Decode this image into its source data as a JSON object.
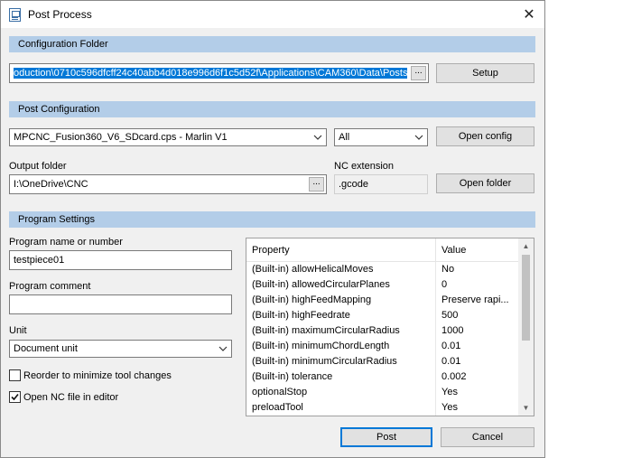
{
  "window": {
    "title": "Post Process",
    "close_glyph": "✕"
  },
  "sections": {
    "config_folder": "Configuration Folder",
    "post_config": "Post Configuration",
    "program_settings": "Program Settings"
  },
  "config_folder": {
    "path": "oduction\\0710c596dfcff24c40abb4d018e996d6f1c5d52f\\Applications\\CAM360\\Data\\Posts",
    "browse": "...",
    "setup_label": "Setup"
  },
  "post_config": {
    "post_selected": "MPCNC_Fusion360_V6_SDcard.cps - Marlin V1",
    "filter_selected": "All",
    "open_config_label": "Open config",
    "output_folder_label": "Output folder",
    "output_folder_value": "I:\\OneDrive\\CNC",
    "browse": "...",
    "nc_extension_label": "NC extension",
    "nc_extension_value": ".gcode",
    "open_folder_label": "Open folder"
  },
  "program": {
    "name_label": "Program name or number",
    "name_value": "testpiece01",
    "comment_label": "Program comment",
    "comment_value": "",
    "unit_label": "Unit",
    "unit_selected": "Document unit",
    "reorder_label": "Reorder to minimize tool changes",
    "reorder_checked": false,
    "open_nc_label": "Open NC file in editor",
    "open_nc_checked": true
  },
  "properties": {
    "columns": [
      "Property",
      "Value"
    ],
    "rows": [
      {
        "property": "(Built-in) allowHelicalMoves",
        "value": "No"
      },
      {
        "property": "(Built-in) allowedCircularPlanes",
        "value": "0"
      },
      {
        "property": "(Built-in) highFeedMapping",
        "value": "Preserve rapi..."
      },
      {
        "property": "(Built-in) highFeedrate",
        "value": "500"
      },
      {
        "property": "(Built-in) maximumCircularRadius",
        "value": "1000"
      },
      {
        "property": "(Built-in) minimumChordLength",
        "value": "0.01"
      },
      {
        "property": "(Built-in) minimumCircularRadius",
        "value": "0.01"
      },
      {
        "property": "(Built-in) tolerance",
        "value": "0.002"
      },
      {
        "property": "optionalStop",
        "value": "Yes"
      },
      {
        "property": "preloadTool",
        "value": "Yes"
      }
    ]
  },
  "footer": {
    "post_label": "Post",
    "cancel_label": "Cancel"
  },
  "colors": {
    "section_header": "#b3cde8",
    "selection": "#0078d7",
    "dialog_bg": "#f0f0f0"
  }
}
